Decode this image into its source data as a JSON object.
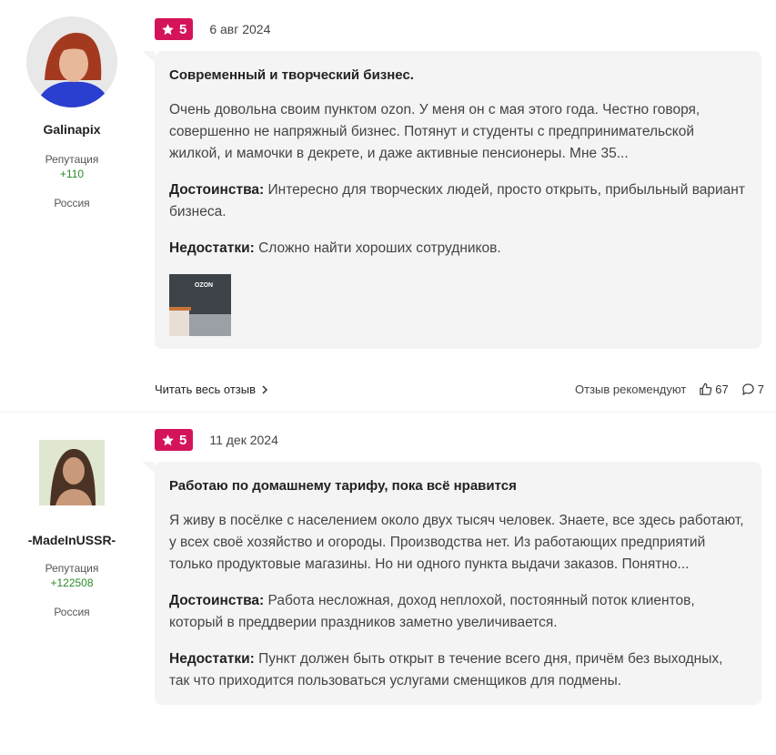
{
  "reviews": [
    {
      "user": {
        "name": "Galinapix",
        "reputation_label": "Репутация",
        "reputation_value": "+110",
        "country": "Россия"
      },
      "rating": "5",
      "date": "6 авг 2024",
      "title": "Современный и творческий бизнес.",
      "text": "Очень довольна своим пунктом ozon. У меня он с мая этого года. Честно говоря, совершенно не напряжный бизнес. Потянут и студенты с предпринимательской жилкой, и мамочки в декрете, и даже активные пенсионеры. Мне 35...",
      "pros_label": "Достоинства:",
      "pros": "Интересно для творческих людей, просто открыть, прибыльный вариант бизнеса.",
      "cons_label": "Недостатки:",
      "cons": "Сложно найти хороших сотрудников.",
      "photo_text": "OZON",
      "read_more": "Читать весь отзыв",
      "recommend": "Отзыв рекомендуют",
      "likes": "67",
      "comments": "7"
    },
    {
      "user": {
        "name": "-MadeInUSSR-",
        "reputation_label": "Репутация",
        "reputation_value": "+122508",
        "country": "Россия"
      },
      "rating": "5",
      "date": "11 дек 2024",
      "title": "Работаю по домашнему тарифу, пока всё нравится",
      "text": "Я живу в посёлке с населением около двух тысяч человек. Знаете, все здесь работают, у всех своё хозяйство и огороды. Производства нет. Из работающих предприятий только продуктовые магазины. Но ни одного пункта выдачи заказов. Понятно...",
      "pros_label": "Достоинства:",
      "pros": "Работа несложная, доход неплохой, постоянный поток клиентов, который в преддверии праздников заметно увеличивается.",
      "cons_label": "Недостатки:",
      "cons": "Пункт должен быть открыт в течение всего дня, причём без выходных, так что приходится пользоваться услугами сменщиков для подмены."
    }
  ],
  "colors": {
    "badge": "#d4145a",
    "reputation": "#2a8a2a",
    "bubble": "#f4f4f4"
  }
}
